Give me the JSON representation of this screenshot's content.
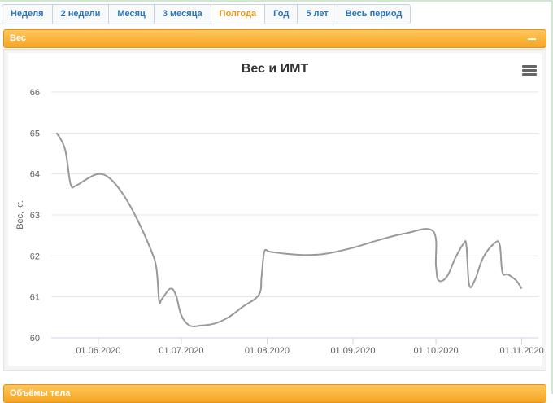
{
  "tabs": [
    {
      "label": "Неделя",
      "active": false
    },
    {
      "label": "2 недели",
      "active": false
    },
    {
      "label": "Месяц",
      "active": false
    },
    {
      "label": "3 месяца",
      "active": false
    },
    {
      "label": "Полгода",
      "active": true
    },
    {
      "label": "Год",
      "active": false
    },
    {
      "label": "5 лет",
      "active": false
    },
    {
      "label": "Весь период",
      "active": false
    }
  ],
  "panels": {
    "weight": {
      "title": "Вес",
      "collapse_icon": "minus-icon"
    },
    "body": {
      "title": "Объёмы тела"
    }
  },
  "colors": {
    "accent": "#f5a623",
    "tab_text": "#2a73b8",
    "tab_active": "#e8961c",
    "series": "#999999"
  },
  "chart_data": {
    "type": "line",
    "title": "Вес и ИМТ",
    "ylabel": "Вес, кг.",
    "xlabel": "",
    "ylim": [
      60,
      66
    ],
    "yticks": [
      60,
      61,
      62,
      63,
      64,
      65,
      66
    ],
    "xlim": [
      "2020-05-15",
      "2020-11-07"
    ],
    "xticks": [
      {
        "date": "2020-06-01",
        "label": "01.06.2020"
      },
      {
        "date": "2020-07-01",
        "label": "01.07.2020"
      },
      {
        "date": "2020-08-01",
        "label": "01.08.2020"
      },
      {
        "date": "2020-09-01",
        "label": "01.09.2020"
      },
      {
        "date": "2020-10-01",
        "label": "01.10.2020"
      },
      {
        "date": "2020-11-01",
        "label": "01.11.2020"
      }
    ],
    "grid": true,
    "legend": "none",
    "series": [
      {
        "x": [
          "2020-05-17",
          "2020-05-20",
          "2020-05-22",
          "2020-05-24",
          "2020-05-28",
          "2020-06-01",
          "2020-06-05",
          "2020-06-10",
          "2020-06-15",
          "2020-06-20",
          "2020-06-22",
          "2020-06-23",
          "2020-06-24",
          "2020-06-27",
          "2020-06-29",
          "2020-07-01",
          "2020-07-04",
          "2020-07-08",
          "2020-07-13",
          "2020-07-18",
          "2020-07-23",
          "2020-07-29",
          "2020-07-30",
          "2020-07-31",
          "2020-08-02",
          "2020-08-08",
          "2020-08-15",
          "2020-08-22",
          "2020-09-01",
          "2020-09-10",
          "2020-09-20",
          "2020-09-30",
          "2020-10-01",
          "2020-10-02",
          "2020-10-05",
          "2020-10-08",
          "2020-10-11",
          "2020-10-12",
          "2020-10-13",
          "2020-10-15",
          "2020-10-18",
          "2020-10-22",
          "2020-10-24",
          "2020-10-25",
          "2020-10-27",
          "2020-10-30",
          "2020-11-01"
        ],
        "values": [
          65.0,
          64.6,
          63.75,
          63.72,
          63.88,
          64.0,
          63.9,
          63.5,
          62.9,
          62.15,
          61.7,
          60.9,
          60.95,
          61.2,
          61.05,
          60.55,
          60.3,
          60.3,
          60.35,
          60.5,
          60.75,
          61.05,
          61.5,
          62.1,
          62.1,
          62.05,
          62.02,
          62.05,
          62.2,
          62.38,
          62.55,
          62.6,
          61.75,
          61.4,
          61.5,
          61.95,
          62.3,
          62.25,
          61.3,
          61.4,
          61.95,
          62.3,
          62.28,
          61.6,
          61.55,
          61.4,
          61.2
        ]
      }
    ]
  }
}
